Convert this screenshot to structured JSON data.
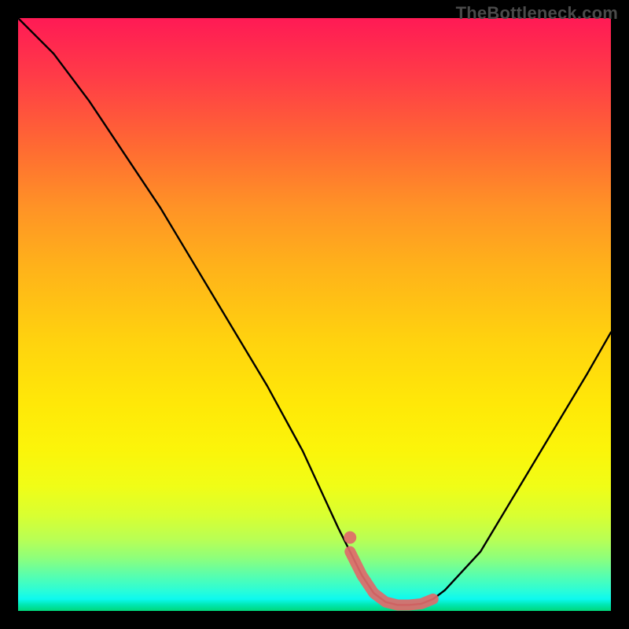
{
  "watermark": "TheBottleneck.com",
  "chart_data": {
    "type": "line",
    "title": "",
    "xlabel": "",
    "ylabel": "",
    "xlim": [
      0,
      100
    ],
    "ylim": [
      0,
      100
    ],
    "series": [
      {
        "name": "bottleneck-curve",
        "color": "#000000",
        "x": [
          0,
          6,
          12,
          18,
          24,
          30,
          36,
          42,
          48,
          54,
          56,
          58,
          60,
          62,
          64,
          66,
          68,
          70,
          72,
          78,
          84,
          90,
          96,
          100
        ],
        "y": [
          100,
          94,
          86,
          77,
          68,
          58,
          48,
          38,
          27,
          14,
          10,
          6,
          3,
          1.5,
          1,
          1,
          1.2,
          2,
          3.5,
          10,
          20,
          30,
          40,
          47
        ]
      },
      {
        "name": "optimal-range-highlight",
        "color": "#e86b6b",
        "x": [
          56,
          58,
          60,
          62,
          64,
          66,
          68,
          70
        ],
        "y": [
          10,
          6,
          3,
          1.5,
          1,
          1,
          1.2,
          2
        ]
      }
    ],
    "gradient": {
      "top": "#ff1a55",
      "mid": "#ffe000",
      "bottom": "#00d87a"
    }
  }
}
